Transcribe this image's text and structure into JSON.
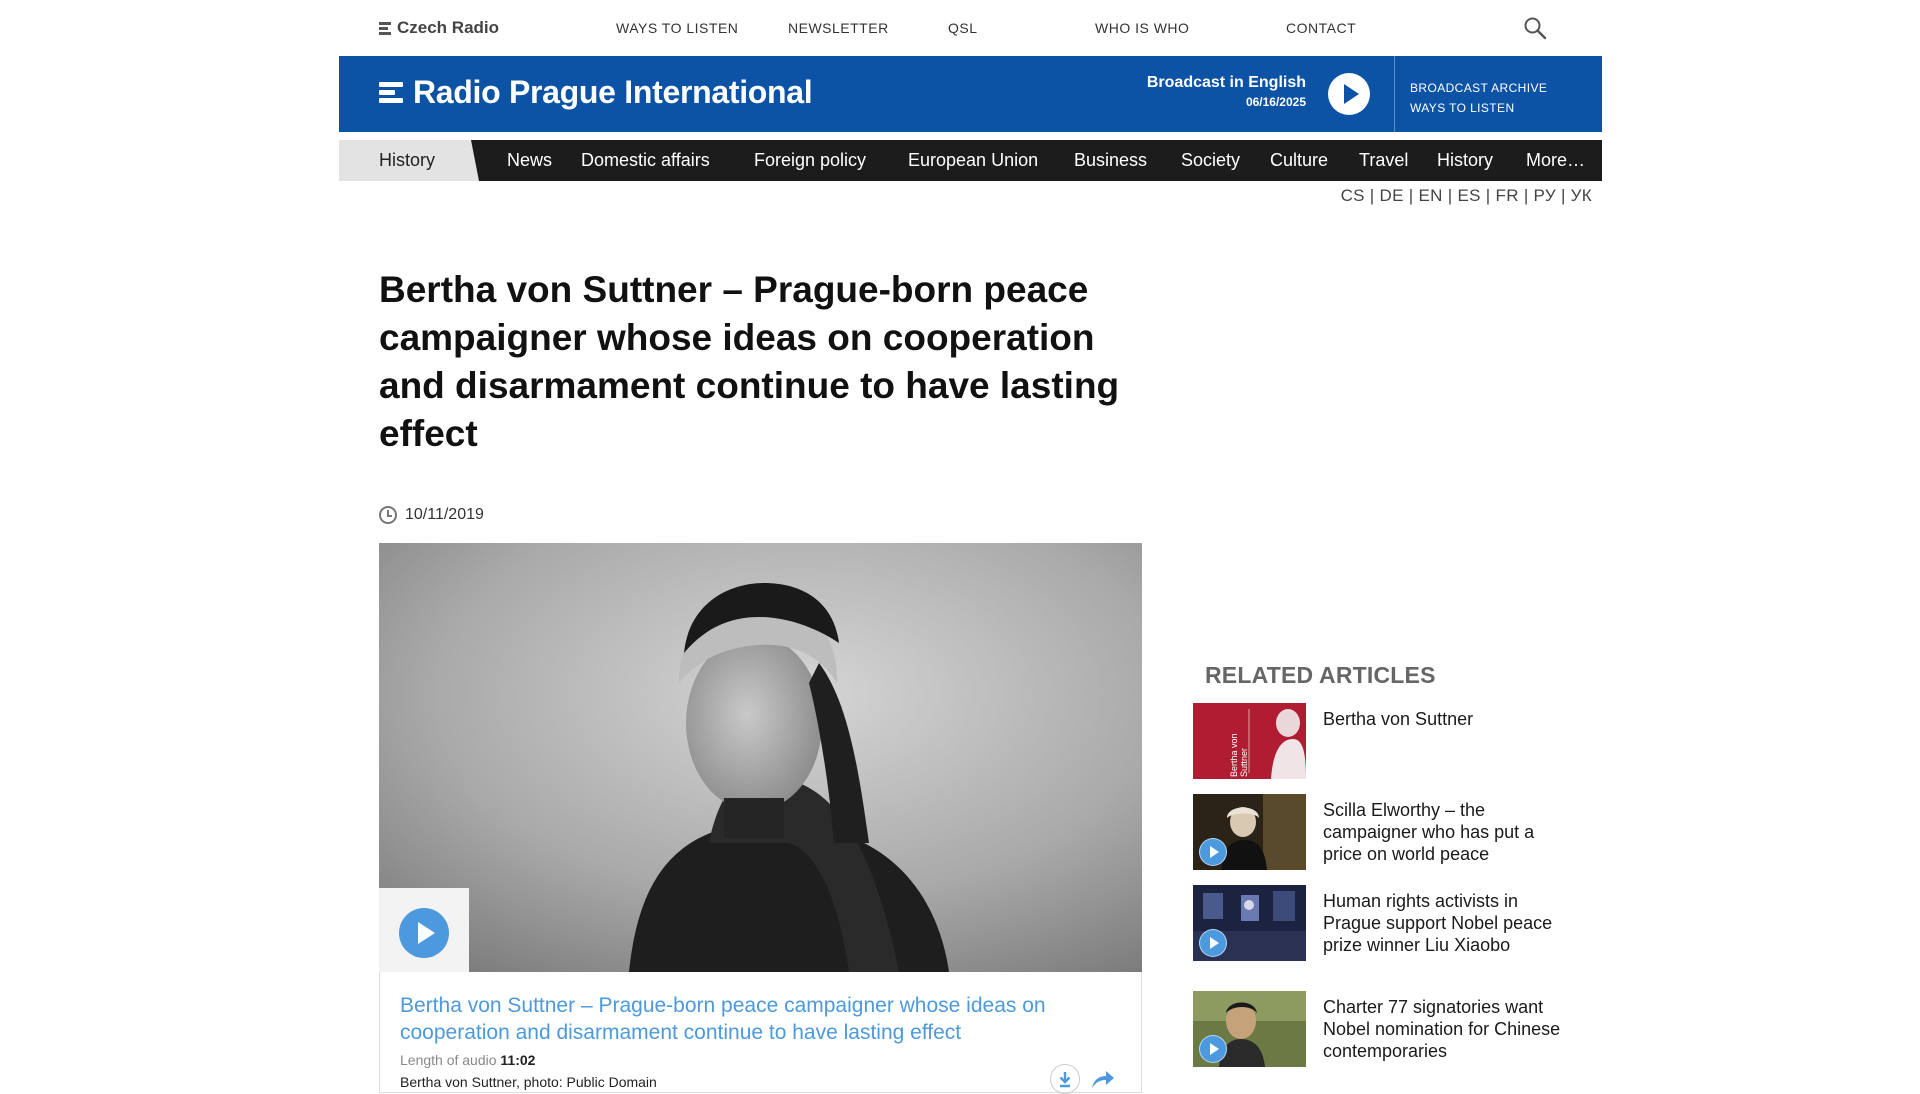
{
  "topbar": {
    "brand": "Czech Radio",
    "links": [
      "WAYS TO LISTEN",
      "NEWSLETTER",
      "QSL",
      "WHO IS WHO",
      "CONTACT"
    ]
  },
  "header": {
    "site_name": "Radio Prague International",
    "broadcast_label": "Broadcast in English",
    "broadcast_date": "06/16/2025",
    "archive_link": "BROADCAST ARCHIVE",
    "listen_link": "WAYS TO LISTEN",
    "accent": "#0c53a6"
  },
  "nav": {
    "current_section": "History",
    "items": [
      "News",
      "Domestic affairs",
      "Foreign policy",
      "European Union",
      "Business",
      "Society",
      "Culture",
      "Travel",
      "History",
      "More…"
    ]
  },
  "languages": "CS | DE | EN | ES | FR | РУ | УК",
  "article": {
    "title": "Bertha von Suttner – Prague-born peace campaigner whose ideas on cooperation and disarmament continue to have lasting effect",
    "date": "10/11/2019",
    "audio_title": "Bertha von Suttner – Prague-born peace campaigner whose ideas on cooperation and disarmament continue to have lasting effect",
    "audio_length_label": "Length of audio",
    "audio_length": "11:02",
    "photo_caption": "Bertha von Suttner, photo: Public Domain"
  },
  "related": {
    "heading": "RELATED ARTICLES",
    "items": [
      {
        "title": "Bertha von Suttner",
        "thumb_text": "Bertha von Suttner"
      },
      {
        "title": "Scilla Elworthy – the campaigner who has put a price on world peace"
      },
      {
        "title": "Human rights activists in Prague support Nobel peace prize winner Liu Xiaobo"
      },
      {
        "title": "Charter 77 signatories want Nobel nomination for Chinese contemporaries"
      }
    ]
  },
  "colors": {
    "link_blue": "#4c99dd",
    "nav_bg": "#1c1c1c"
  }
}
